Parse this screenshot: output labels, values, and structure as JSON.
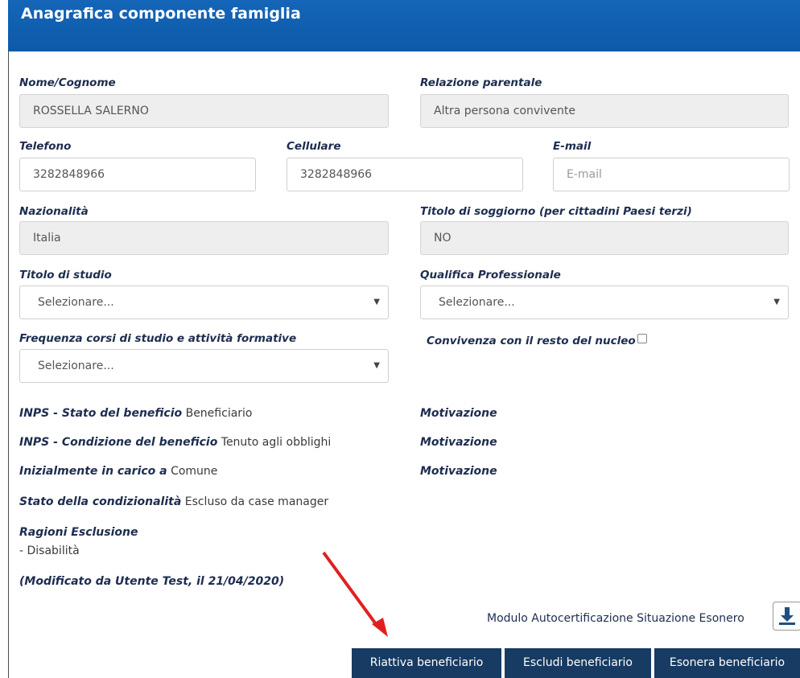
{
  "header": {
    "title": "Anagrafica componente famiglia"
  },
  "fields": {
    "nome": {
      "label": "Nome/Cognome",
      "value": "ROSSELLA SALERNO"
    },
    "relazione": {
      "label": "Relazione parentale",
      "value": "Altra persona convivente"
    },
    "telefono": {
      "label": "Telefono",
      "value": "3282848966"
    },
    "cellulare": {
      "label": "Cellulare",
      "value": "3282848966"
    },
    "email": {
      "label": "E-mail",
      "placeholder": "E-mail"
    },
    "nazionalita": {
      "label": "Nazionalità",
      "value": "Italia"
    },
    "titolo_soggiorno": {
      "label": "Titolo di soggiorno (per cittadini Paesi terzi)",
      "value": "NO"
    },
    "titolo_studio": {
      "label": "Titolo di studio",
      "selected": "Selezionare..."
    },
    "qualifica": {
      "label": "Qualifica Professionale",
      "selected": "Selezionare..."
    },
    "frequenza": {
      "label": "Frequenza corsi di studio e attività formative",
      "selected": "Selezionare..."
    },
    "convivenza": {
      "label": "Convivenza con il resto del nucleo"
    }
  },
  "info": {
    "stato_beneficio": {
      "label": "INPS - Stato del beneficio",
      "value": "Beneficiario"
    },
    "condizione_beneficio": {
      "label": "INPS - Condizione del beneficio",
      "value": "Tenuto agli obblighi"
    },
    "in_carico": {
      "label": "Inizialmente in carico a",
      "value": "Comune"
    },
    "condizionalita": {
      "label": "Stato della condizionalità",
      "value": "Escluso da case manager"
    },
    "motivazione": "Motivazione",
    "ragioni_label": "Ragioni Esclusione",
    "ragioni_value": "- Disabilità",
    "modificato": "(Modificato da Utente Test, il 21/04/2020)"
  },
  "modulo_label": "Modulo Autocertificazione Situazione Esonero",
  "buttons": {
    "riattiva": "Riattiva beneficiario",
    "escludi": "Escludi beneficiario",
    "esonera": "Esonera beneficiario"
  },
  "colors": {
    "header": "#1565b8",
    "button": "#173b62",
    "arrow": "#e02020"
  },
  "icons": {
    "download": "download-icon",
    "caret": "caret-down-icon"
  }
}
